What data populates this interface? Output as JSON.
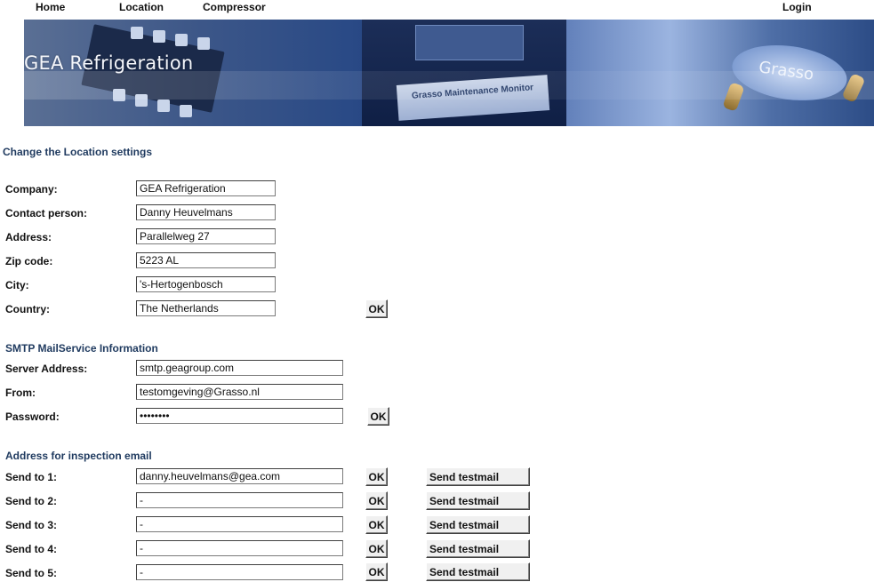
{
  "nav": {
    "home": "Home",
    "location": "Location",
    "compressor": "Compressor",
    "login": "Login"
  },
  "banner": {
    "title": "GEA Refrigeration",
    "monitor_label": "Grasso Maintenance Monitor",
    "logo_text": "Grasso"
  },
  "page_title": "Change the Location settings",
  "location": {
    "fields": [
      {
        "label": "Company:",
        "value": "GEA Refrigeration"
      },
      {
        "label": "Contact person:",
        "value": "Danny Heuvelmans"
      },
      {
        "label": "Address:",
        "value": "Parallelweg 27"
      },
      {
        "label": "Zip code:",
        "value": "5223 AL"
      },
      {
        "label": "City:",
        "value": "'s-Hertogenbosch"
      },
      {
        "label": "Country:",
        "value": "The Netherlands"
      }
    ],
    "ok_label": "OK"
  },
  "smtp": {
    "title": "SMTP MailService Information",
    "server_label": "Server Address:",
    "server_value": "smtp.geagroup.com",
    "from_label": "From:",
    "from_value": "testomgeving@Grasso.nl",
    "password_label": "Password:",
    "password_value": "••••••••",
    "ok_label": "OK"
  },
  "inspection": {
    "title": "Address for inspection email",
    "rows": [
      {
        "label": "Send to 1:",
        "value": "danny.heuvelmans@gea.com",
        "ok": "OK",
        "test": "Send testmail"
      },
      {
        "label": "Send to 2:",
        "value": "-",
        "ok": "OK",
        "test": "Send testmail"
      },
      {
        "label": "Send to 3:",
        "value": "-",
        "ok": "OK",
        "test": "Send testmail"
      },
      {
        "label": "Send to 4:",
        "value": "-",
        "ok": "OK",
        "test": "Send testmail"
      },
      {
        "label": "Send to 5:",
        "value": "-",
        "ok": "OK",
        "test": "Send testmail"
      }
    ]
  }
}
